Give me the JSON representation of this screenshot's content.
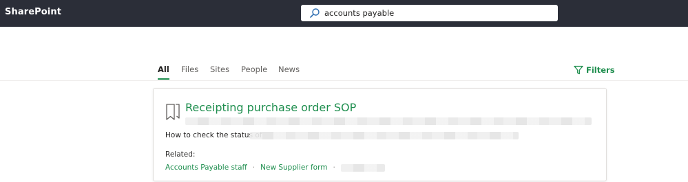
{
  "app": {
    "name": "SharePoint"
  },
  "search": {
    "query": "accounts payable"
  },
  "tabs": [
    {
      "label": "All",
      "active": true
    },
    {
      "label": "Files",
      "active": false
    },
    {
      "label": "Sites",
      "active": false
    },
    {
      "label": "People",
      "active": false
    },
    {
      "label": "News",
      "active": false
    }
  ],
  "filters": {
    "label": "Filters",
    "icon": "filter-icon"
  },
  "result": {
    "title": "Receipting purchase order SOP",
    "snippet_prefix": "How to check the status of",
    "related_label": "Related:",
    "related_links": [
      "Accounts Payable staff",
      "New Supplier form"
    ],
    "icon": "document-bookmark-icon"
  },
  "colors": {
    "topbar": "#2b2e38",
    "accent": "#1e8e4e",
    "text": "#323130"
  }
}
